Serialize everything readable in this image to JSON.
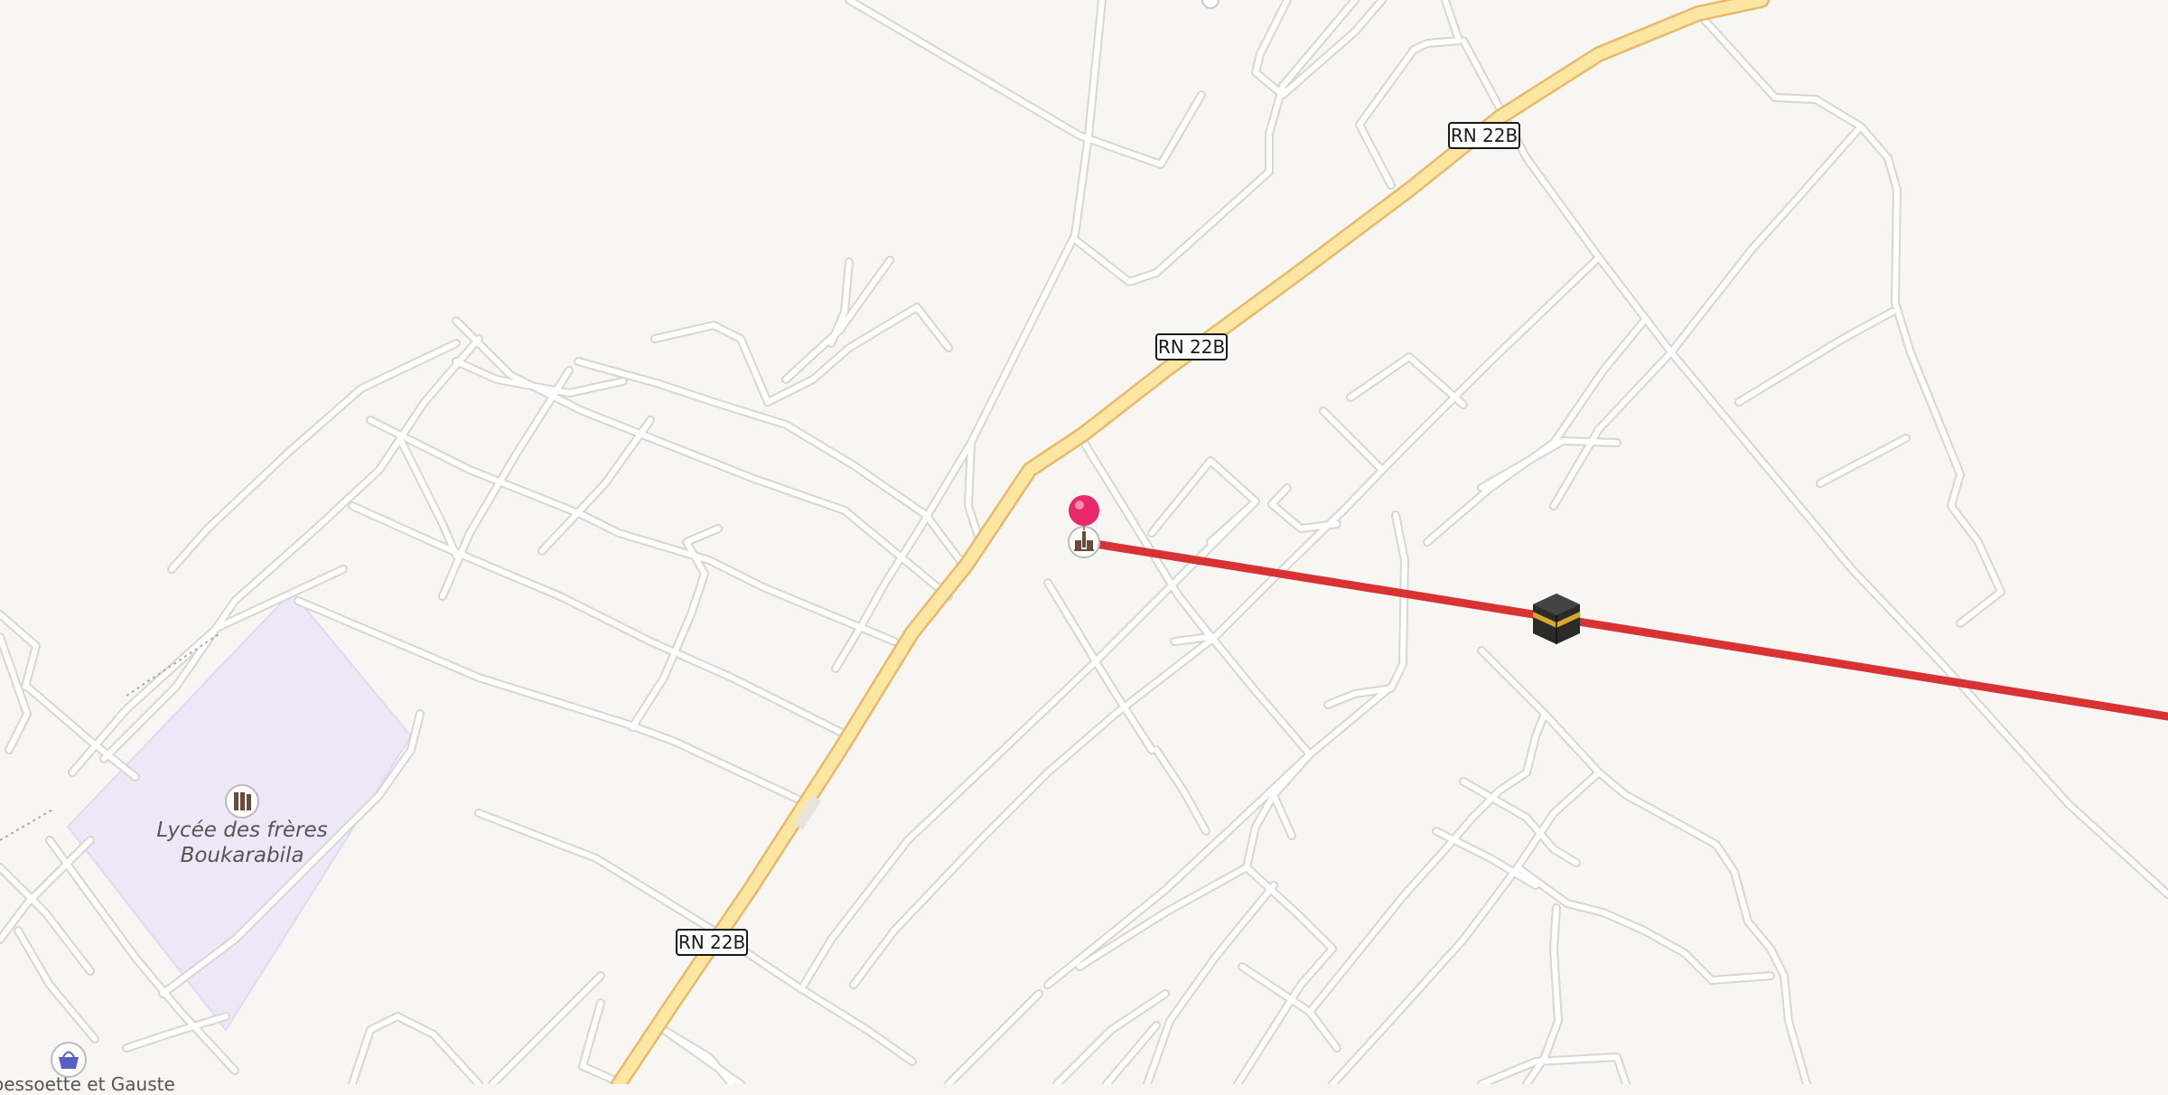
{
  "map": {
    "road_shield": "RN 22B",
    "school": {
      "name_line1": "Lycée des frères",
      "name_line2": "Boukarabila",
      "icon": "school-icon"
    },
    "shop": {
      "label_partial": "oessoette et Gauste",
      "icon": "shopping-basket-icon"
    },
    "markers": {
      "location_pin": "location-pin-icon",
      "mosque": "mosque-icon",
      "kaaba": "kaaba-icon"
    },
    "colors": {
      "background": "#f8f6f2",
      "primary_road": "#fde6a2",
      "primary_road_casing": "#e8b96a",
      "minor_road": "#ffffff",
      "school_area": "#ede7f8",
      "qibla_line": "#d83232",
      "pin": "#e8286a"
    }
  }
}
